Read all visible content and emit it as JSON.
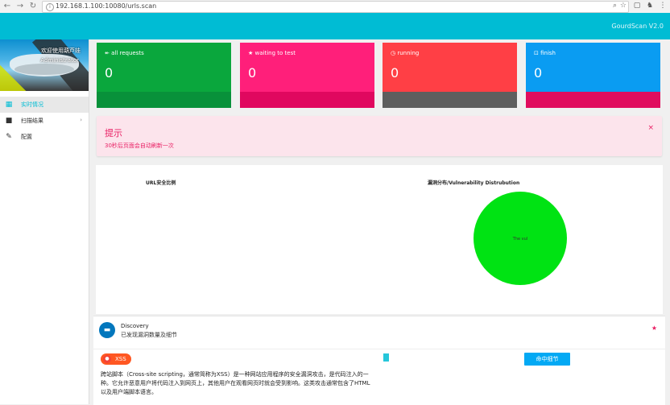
{
  "browser": {
    "url": "192.168.1.100:10080/urls.scan"
  },
  "app": {
    "version": "GourdScan V2.0"
  },
  "sidebar": {
    "profile_name": "欢迎使用葫芦娃",
    "profile_role": "Administrator",
    "items": [
      {
        "label": "实时情况",
        "icon": "dashboard-icon",
        "active": true
      },
      {
        "label": "扫描结果",
        "icon": "briefcase-icon",
        "active": false
      },
      {
        "label": "配置",
        "icon": "wrench-icon",
        "active": false
      }
    ]
  },
  "cards": [
    {
      "title": "all requests",
      "icon": "list-icon",
      "value": "0",
      "color": "#0aa73d",
      "foot": "#08913a"
    },
    {
      "title": "waiting to test",
      "icon": "star-icon",
      "value": "0",
      "color": "#ff1f7a",
      "foot": "#e0085f"
    },
    {
      "title": "running",
      "icon": "clock-icon",
      "value": "0",
      "color": "#ff3f45",
      "foot": "#5e5e5e"
    },
    {
      "title": "finish",
      "icon": "lock-icon",
      "value": "0",
      "color": "#0a9cf2",
      "foot": "#e00d5e"
    }
  ],
  "alert": {
    "title": "提示",
    "message": "30秒后页面会自动刷新一次",
    "close": "×"
  },
  "charts": {
    "left_title": "URL安全比例",
    "right_title": "漏洞分布/Vulnerability Distrubution"
  },
  "chart_data": [
    {
      "type": "pie",
      "title": "URL安全比例",
      "slices": []
    },
    {
      "type": "pie",
      "title": "漏洞分布/Vulnerability Distrubution",
      "slices": [
        {
          "label": "The vul",
          "value": 100,
          "color": "#00e313"
        }
      ]
    }
  ],
  "discovery": {
    "title": "Discovery",
    "subtitle": "已发现漏洞数量及细节",
    "star": "★",
    "tag_label": "XSS",
    "hit_button": "命中细节",
    "description": "跨站脚本（Cross-site scripting，通常简称为XSS）是一种网站应用程序的安全漏洞攻击，是代码注入的一种。它允许恶意用户将代码注入到网页上，其他用户在观看网页时就会受到影响。这类攻击通常包含了HTML以及用户端脚本语言。"
  }
}
